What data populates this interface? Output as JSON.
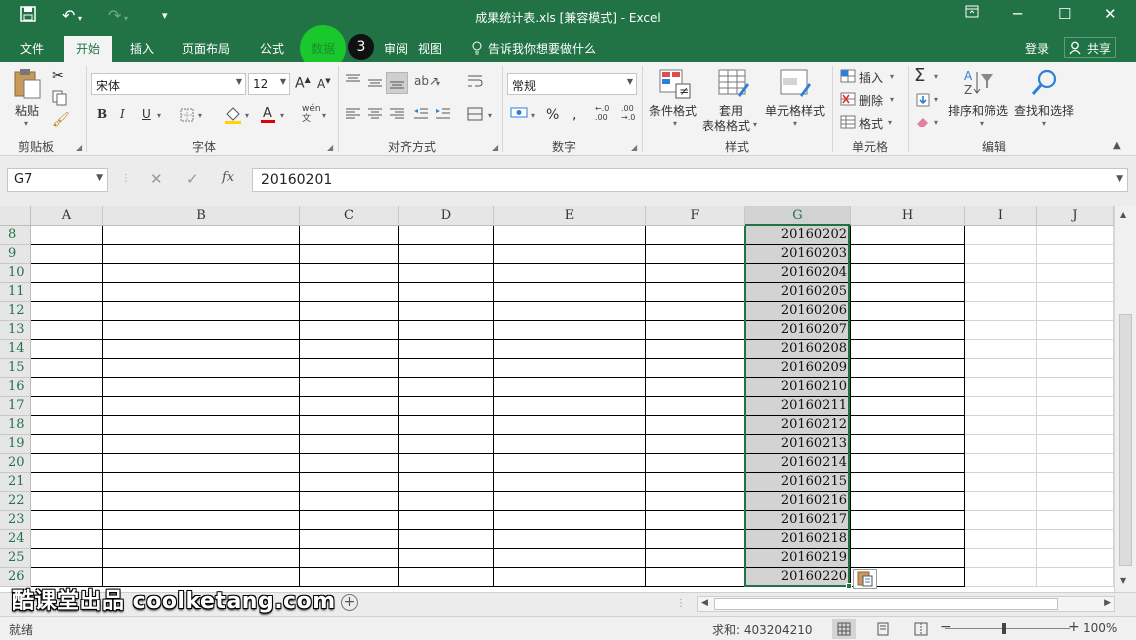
{
  "window": {
    "title": "成果统计表.xls  [兼容模式] - Excel"
  },
  "tabs": [
    "文件",
    "开始",
    "插入",
    "页面布局",
    "公式",
    "数据",
    "审阅",
    "视图"
  ],
  "active_tab": "开始",
  "tell_me": "告诉我你想要做什么",
  "account": {
    "login": "登录",
    "share": "共享"
  },
  "tutorial": {
    "step": "3"
  },
  "ribbon": {
    "clipboard": {
      "paste": "粘贴",
      "label": "剪贴板"
    },
    "font": {
      "name": "宋体",
      "size": "12",
      "label": "字体"
    },
    "alignment": {
      "label": "对齐方式"
    },
    "number": {
      "format": "常规",
      "label": "数字"
    },
    "styles": {
      "conditional": "条件格式",
      "table_line1": "套用",
      "table_line2": "表格格式",
      "cell_styles": "单元格样式",
      "label": "样式"
    },
    "cells": {
      "insert": "插入",
      "delete": "删除",
      "format": "格式",
      "label": "单元格"
    },
    "editing": {
      "sort": "排序和筛选",
      "find": "查找和选择",
      "label": "编辑"
    }
  },
  "formula_bar": {
    "name_box": "G7",
    "fx": "fx",
    "value": "20160201"
  },
  "columns": [
    "A",
    "B",
    "C",
    "D",
    "E",
    "F",
    "G",
    "H",
    "I",
    "J"
  ],
  "selected_column": "G",
  "rows": [
    {
      "num": "8",
      "g": "20160202"
    },
    {
      "num": "9",
      "g": "20160203"
    },
    {
      "num": "10",
      "g": "20160204"
    },
    {
      "num": "11",
      "g": "20160205"
    },
    {
      "num": "12",
      "g": "20160206"
    },
    {
      "num": "13",
      "g": "20160207"
    },
    {
      "num": "14",
      "g": "20160208"
    },
    {
      "num": "15",
      "g": "20160209"
    },
    {
      "num": "16",
      "g": "20160210"
    },
    {
      "num": "17",
      "g": "20160211"
    },
    {
      "num": "18",
      "g": "20160212"
    },
    {
      "num": "19",
      "g": "20160213"
    },
    {
      "num": "20",
      "g": "20160214"
    },
    {
      "num": "21",
      "g": "20160215"
    },
    {
      "num": "22",
      "g": "20160216"
    },
    {
      "num": "23",
      "g": "20160217"
    },
    {
      "num": "24",
      "g": "20160218"
    },
    {
      "num": "25",
      "g": "20160219"
    },
    {
      "num": "26",
      "g": "20160220"
    }
  ],
  "watermark": "酷课堂出品 coolketang.com",
  "status_bar": {
    "mode": "就绪",
    "sum": "求和: 403204210",
    "zoom": "100%"
  },
  "colors": {
    "accent": "#217346",
    "selection": "#d3d3d3",
    "cursor_highlight": "#19cf2b"
  }
}
